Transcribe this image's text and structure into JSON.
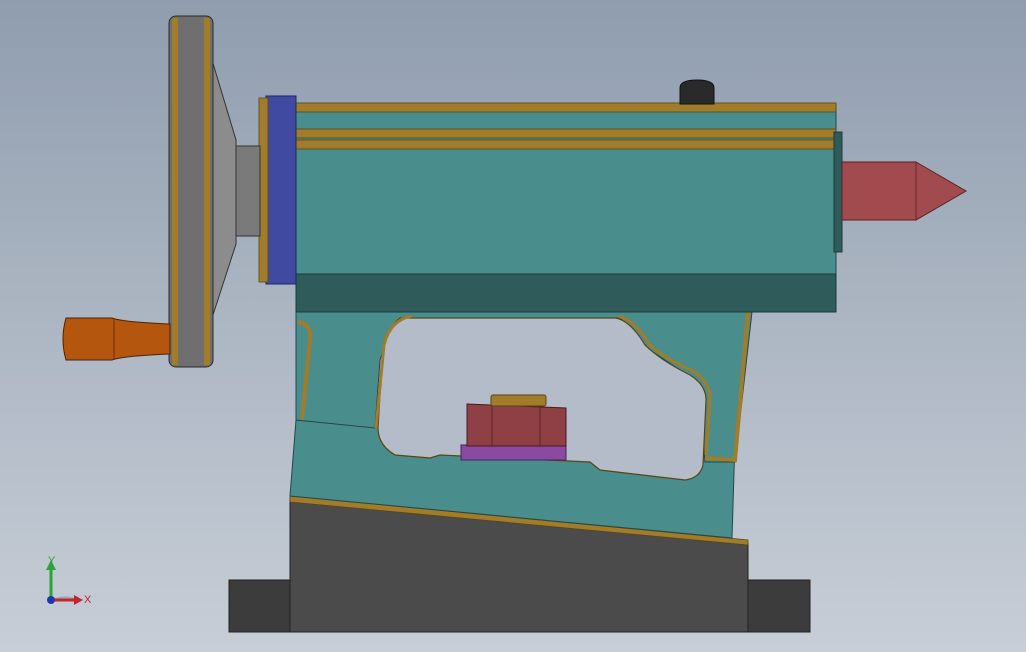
{
  "scene": {
    "description_free": true,
    "colors": {
      "background_top": "#8f9daf",
      "background_bottom": "#c7ced7",
      "casting_teal": "#4a8d8d",
      "casting_teal_dark": "#2f5b5b",
      "edge_gold": "#a17c2a",
      "base_gray": "#4a4a4a",
      "foot_gray": "#3c3c3c",
      "handwheel_gray": "#6f6f6f",
      "flange_blue": "#3f4aa0",
      "center_red": "#a24b4e",
      "nut_red": "#8e4045",
      "washer_purple": "#8a4aa0",
      "handle_orange": "#b5560f",
      "knob_black": "#2a2a2a"
    }
  },
  "triad": {
    "x_label": "X",
    "y_label": "Y",
    "x_color": "#c0262c",
    "y_color": "#2aa33a",
    "origin_color": "#1f3aa8"
  }
}
